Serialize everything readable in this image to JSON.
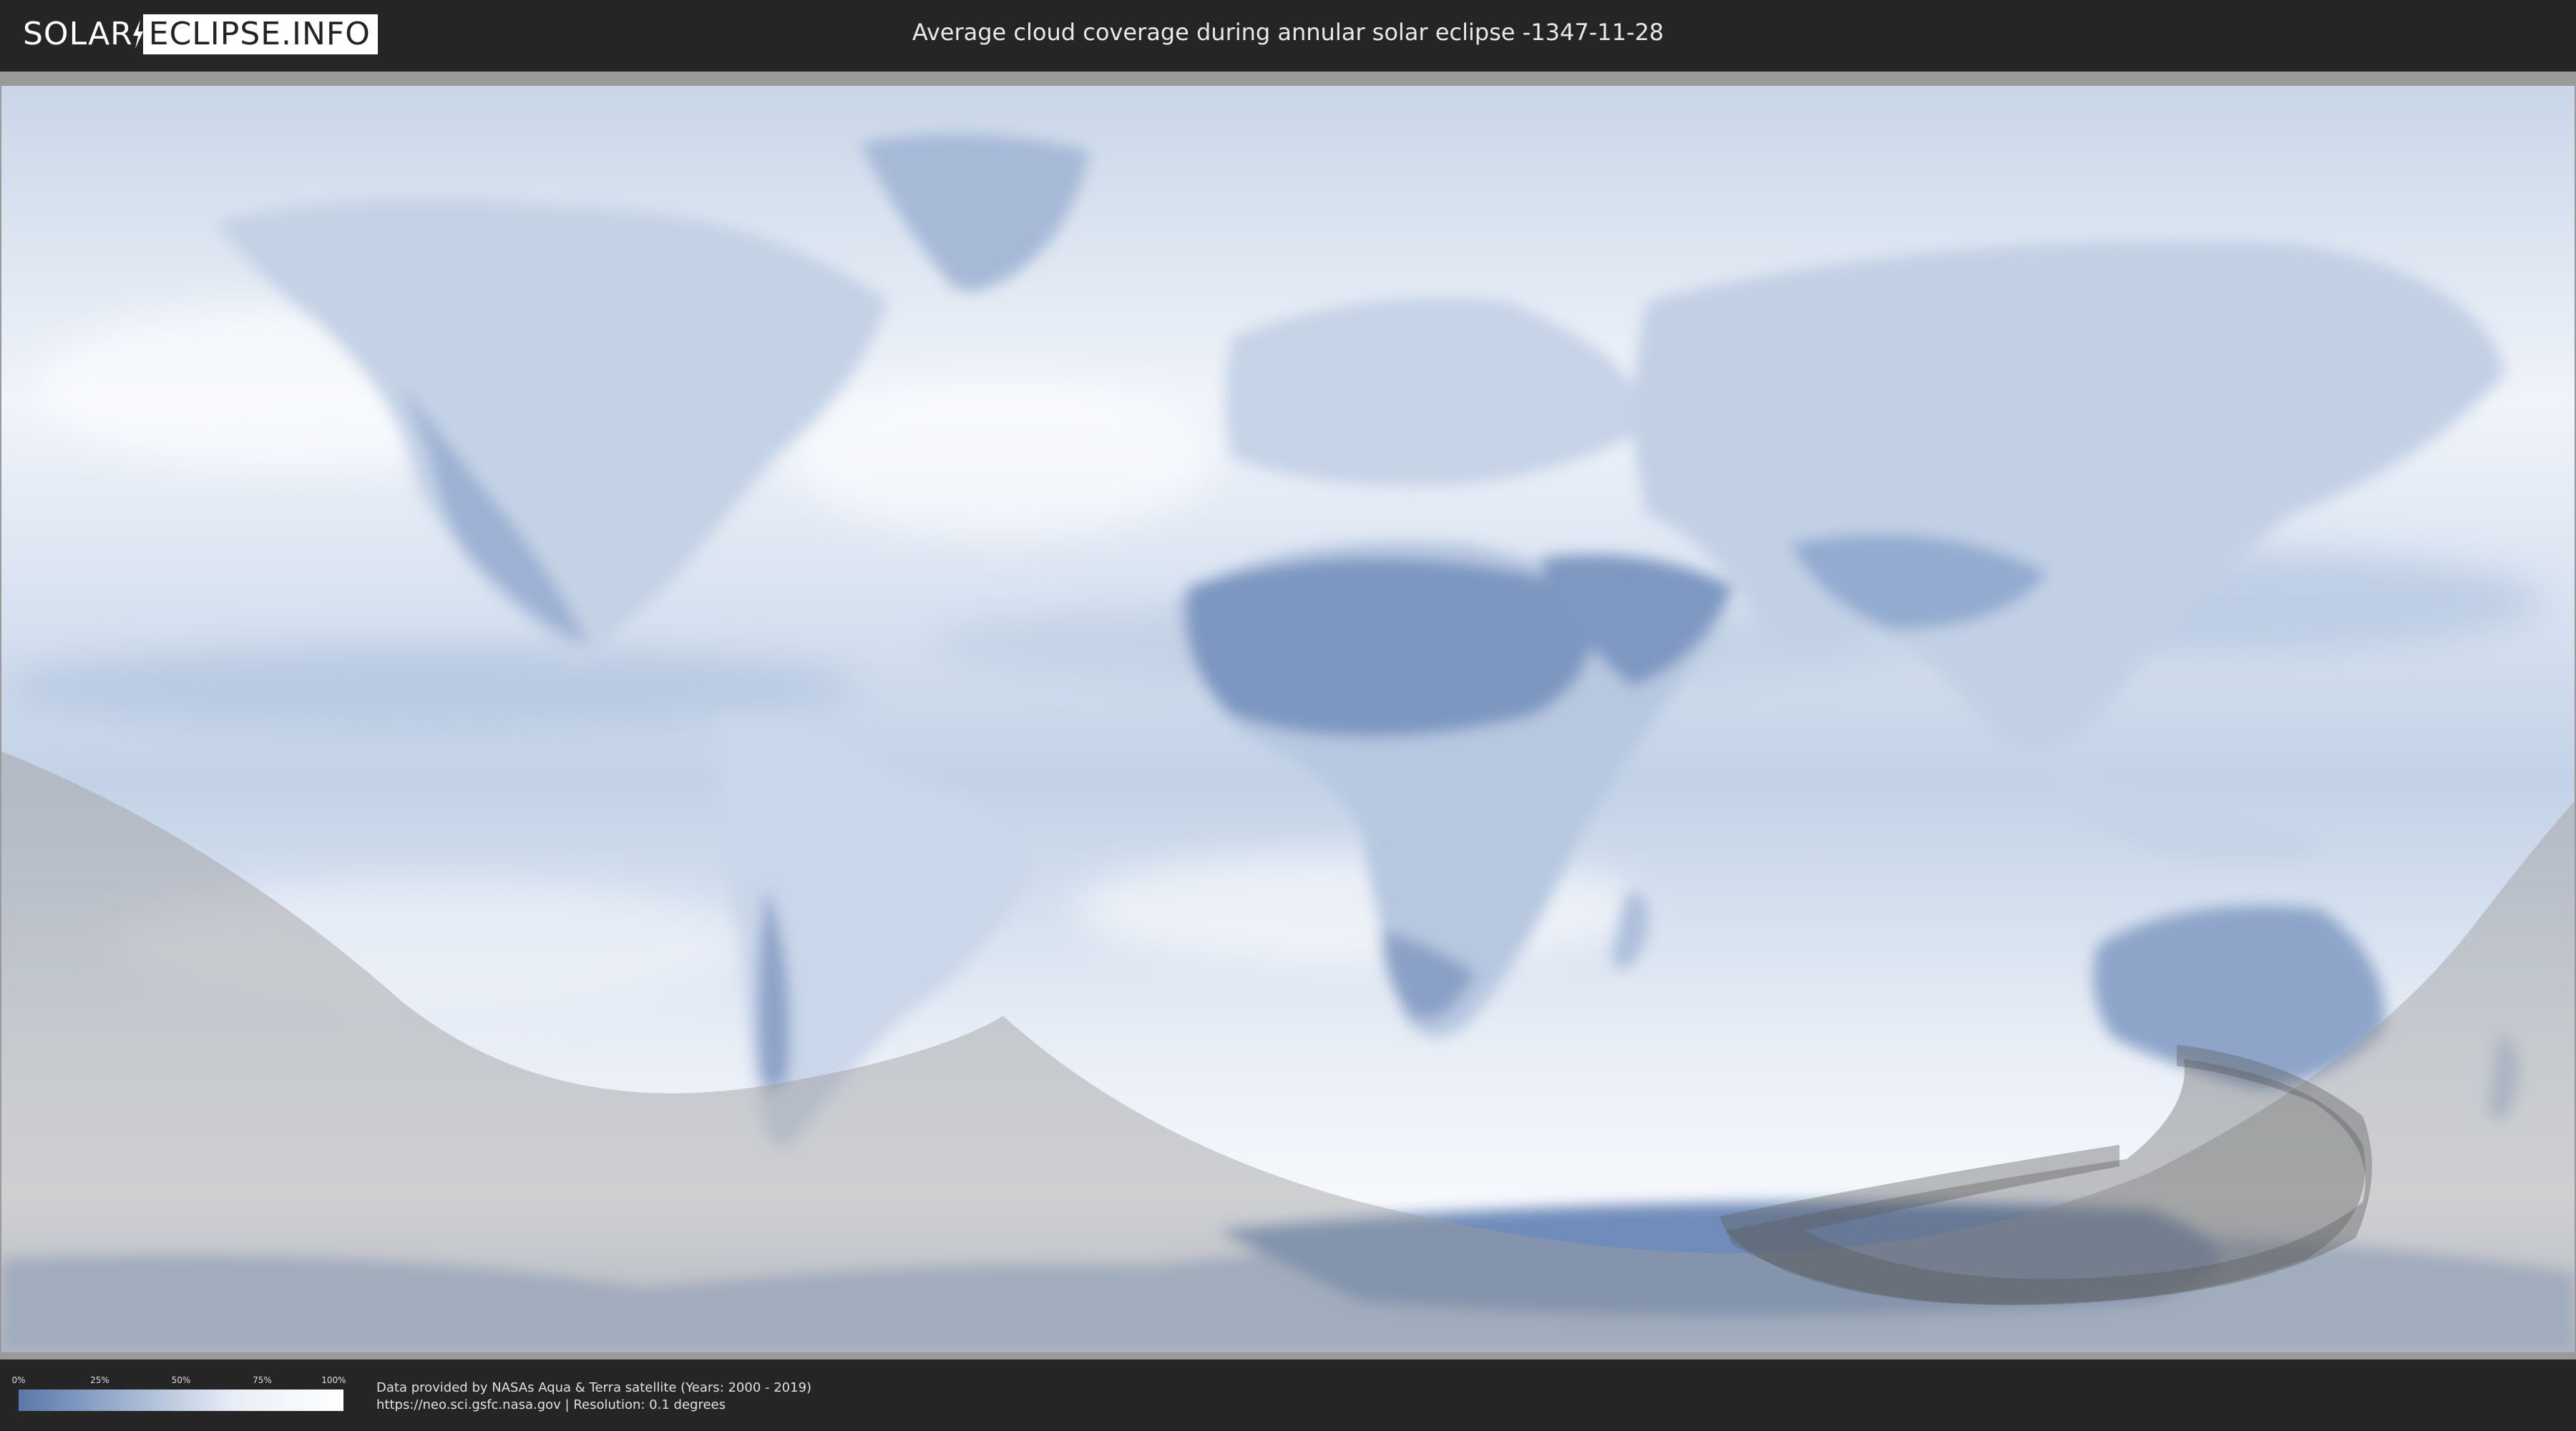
{
  "header": {
    "logo_left": "SOLAR",
    "logo_right": "ECLIPSE.INFO",
    "title": "Average cloud coverage during annular solar eclipse -1347-11-28"
  },
  "legend": {
    "ticks": [
      "0%",
      "25%",
      "50%",
      "75%",
      "100%"
    ],
    "colors": [
      "#5a77a8",
      "#9fb3d2",
      "#e9eef6",
      "#ffffff"
    ]
  },
  "credits": {
    "line1": "Data provided by NASAs Aqua & Terra satellite (Years: 2000 - 2019)",
    "line2": "https://neo.sci.gsfc.nasa.gov | Resolution: 0.1 degrees"
  },
  "map": {
    "ocean_color": "#dfe7f2",
    "land_cloud_color": "#8ea5c9",
    "dry_region_color": "#6f8cba",
    "eclipse_shadow_color": "#9e9e9e",
    "annular_path_color": "#5f5f5f"
  }
}
